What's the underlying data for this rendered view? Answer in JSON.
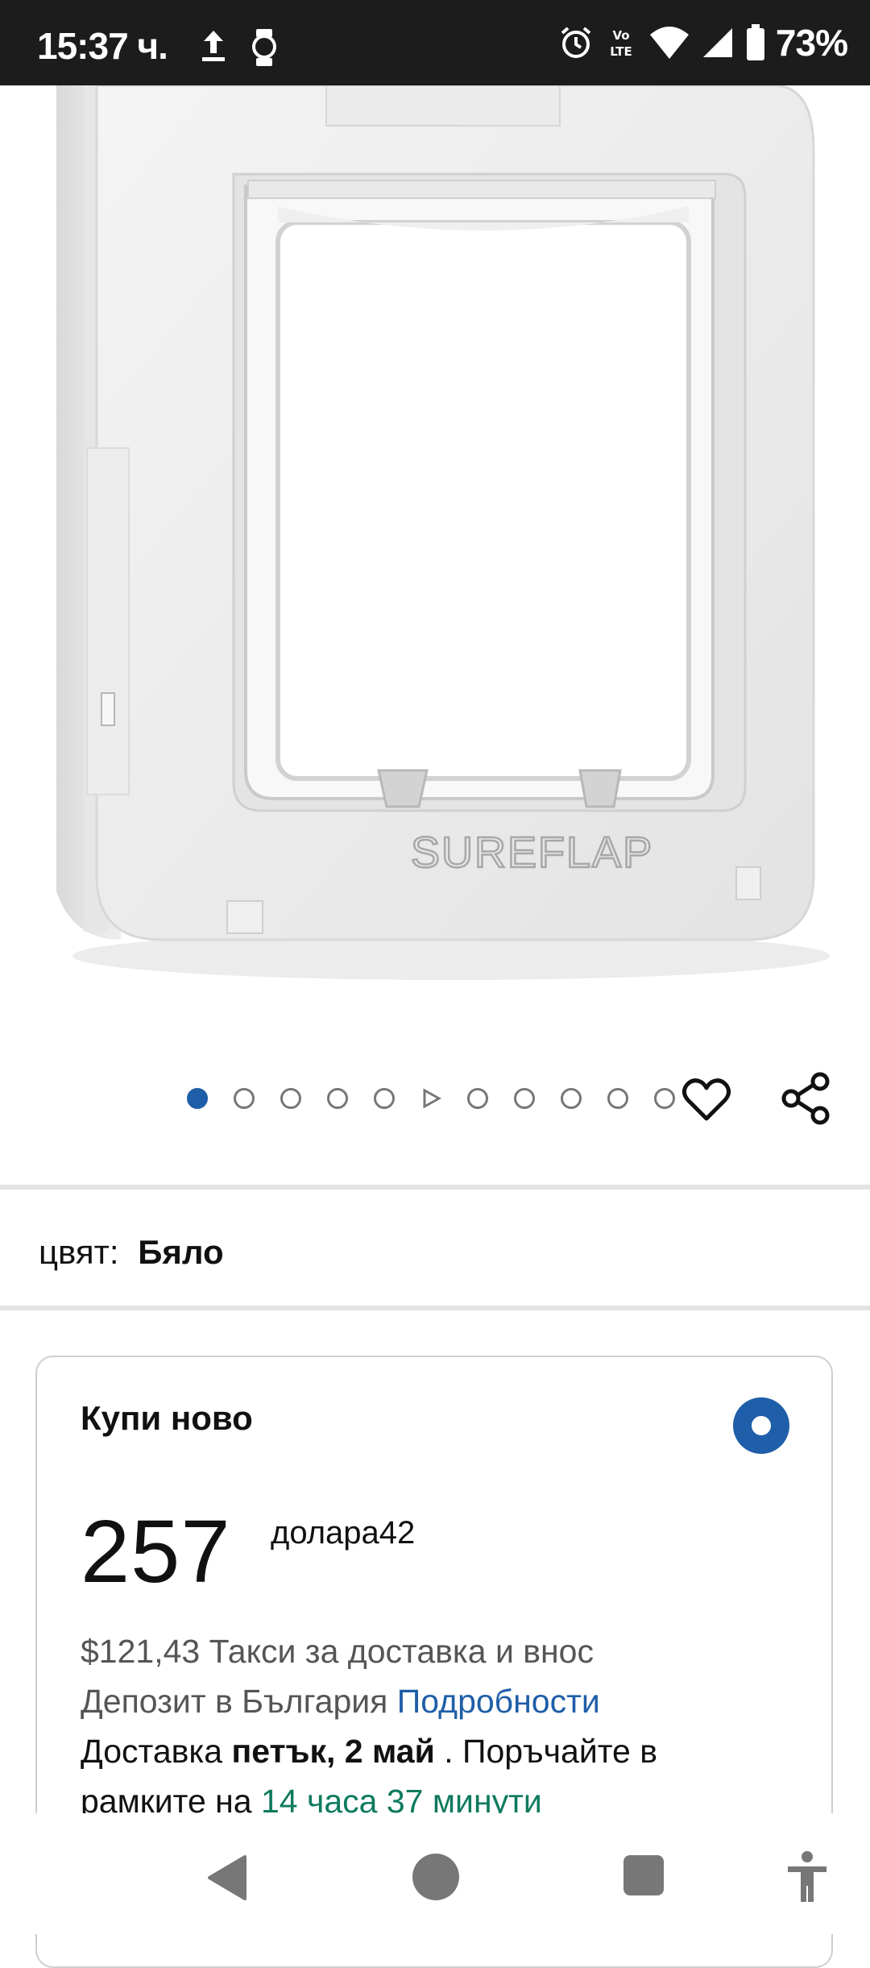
{
  "status_bar": {
    "time": "15:37 ч.",
    "battery": "73%",
    "icons": [
      "upload-icon",
      "smartwatch-icon",
      "alarm-icon",
      "volte-icon",
      "wifi-icon",
      "signal-icon",
      "battery-icon"
    ],
    "volte_label": "Vo LTE"
  },
  "product": {
    "image_alt": "SureFlap",
    "image_brand_text": "SUREFLAP",
    "carousel": {
      "count": 11,
      "active_index": 0,
      "video_index": 5
    }
  },
  "actions": {
    "favorite_icon": "heart-icon",
    "share_icon": "share-icon"
  },
  "color": {
    "label": "цвят:",
    "value": "Бяло"
  },
  "buy_new": {
    "title": "Купи ново",
    "price_whole": "257",
    "price_rest": "долара42",
    "fee_text": "$121,43 Такси за доставка и внос",
    "deposit_text": "Депозит в България",
    "details_link": "Подробности",
    "delivery_prefix": "Доставка",
    "delivery_date": "петък, 2 май",
    "delivery_mid": ". Поръчайте в",
    "delivery_within": "рамките на",
    "countdown": "14 часа 37 минути"
  },
  "colors": {
    "accent": "#1f5ea8",
    "countdown": "#0e7a5e",
    "status_bar": "#1c1c1c"
  }
}
